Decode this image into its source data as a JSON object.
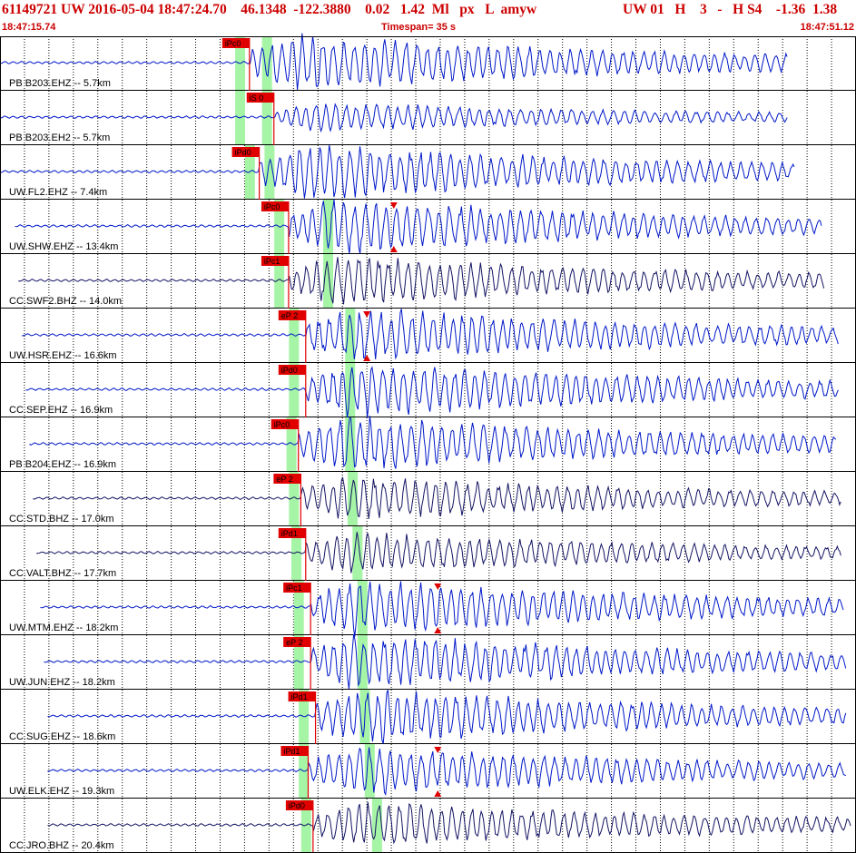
{
  "header": {
    "event_line": "61149721 UW 2016-05-04 18:47:24.70    46.1348  -122.3880    0.02   1.42  Ml   px   L  amyw",
    "quality": "UW 01   H    3   -   H S4    -1.36  1.38",
    "start_time": "18:47:15.74",
    "timespan": "Timespan=  35 s",
    "end_time": "18:47:51.12"
  },
  "colors": {
    "header_text": "#cc0000",
    "trace_blue": "#0018c8",
    "trace_navy": "#141464",
    "pick_flag": "#e00000",
    "window_band": "#a6f5a6",
    "grid": "#000000"
  },
  "chart_data": {
    "type": "line",
    "title": "61149721 UW 2016-05-04 18:47:24.70  46.1348 -122.3880  0.02  1.42 Ml",
    "x_units": "s",
    "x_range": [
      0,
      35
    ],
    "traces": [
      {
        "label": "PB B203.EHZ -- 5.7km",
        "pick": "iPc0",
        "pick_t": 10.2,
        "end_t": 32.2,
        "color": "#0018c8",
        "amp": 1.0,
        "p_window": 9.8,
        "s_window": 10.9,
        "s_marker": false
      },
      {
        "label": "PB B203.EH2 -- 5.7km",
        "pick": "iS 0",
        "pick_t": 11.2,
        "end_t": 32.2,
        "color": "#0018c8",
        "amp": 0.55,
        "p_window": 9.8,
        "s_window": 10.9,
        "s_marker": false
      },
      {
        "label": "UW.FL2.EHZ -- 7.4km",
        "pick": "iPd0",
        "pick_t": 10.6,
        "end_t": 32.5,
        "color": "#0018c8",
        "amp": 1.0,
        "p_window": 10.2,
        "s_window": 11.0,
        "s_marker": false
      },
      {
        "label": "UW.SHW.EHZ -- 13.4km",
        "pick": "iPc0",
        "pick_t": 11.8,
        "end_t": 33.6,
        "color": "#0018c8",
        "amp": 1.0,
        "p_window": 11.4,
        "s_window": 13.4,
        "s_marker": true,
        "s_t": 16.1
      },
      {
        "label": "CC.SWF2.BHZ -- 14.0km",
        "pick": "iPc1",
        "pick_t": 11.8,
        "end_t": 33.7,
        "color": "#141464",
        "amp": 0.9,
        "p_window": 11.4,
        "s_window": 13.4,
        "s_marker": false
      },
      {
        "label": "UW.HSR.EHZ -- 16.6km",
        "pick": "eP 2",
        "pick_t": 12.5,
        "end_t": 34.3,
        "color": "#0018c8",
        "amp": 1.0,
        "p_window": 12.0,
        "s_window": 14.3,
        "s_marker": true,
        "s_t": 15.0
      },
      {
        "label": "CC.SEP.EHZ -- 16.9km",
        "pick": "iPd0",
        "pick_t": 12.5,
        "end_t": 34.3,
        "color": "#0018c8",
        "amp": 1.0,
        "p_window": 12.0,
        "s_window": 14.3,
        "s_marker": false
      },
      {
        "label": "PB B204.EHZ -- 16.9km",
        "pick": "iPc0",
        "pick_t": 12.2,
        "end_t": 34.2,
        "color": "#0018c8",
        "amp": 1.0,
        "p_window": 11.9,
        "s_window": 14.3,
        "s_marker": false
      },
      {
        "label": "CC.STD.BHZ -- 17.0km",
        "pick": "eP 2",
        "pick_t": 12.3,
        "end_t": 34.4,
        "color": "#141464",
        "amp": 0.8,
        "p_window": 12.0,
        "s_window": 14.4,
        "s_marker": false
      },
      {
        "label": "CC.VALT.BHZ -- 17.7km",
        "pick": "iPd1",
        "pick_t": 12.5,
        "end_t": 34.4,
        "color": "#141464",
        "amp": 0.75,
        "p_window": 12.1,
        "s_window": 14.6,
        "s_marker": false
      },
      {
        "label": "UW.MTM.EHZ -- 18.2km",
        "pick": "iPc1",
        "pick_t": 12.7,
        "end_t": 34.5,
        "color": "#0018c8",
        "amp": 1.0,
        "p_window": 12.2,
        "s_window": 14.8,
        "s_marker": true,
        "s_t": 17.9
      },
      {
        "label": "UW.JUN.EHZ -- 18.2km",
        "pick": "eP 2",
        "pick_t": 12.7,
        "end_t": 34.6,
        "color": "#0018c8",
        "amp": 1.0,
        "p_window": 12.2,
        "s_window": 14.8,
        "s_marker": false
      },
      {
        "label": "CC.SUG.EHZ -- 18.6km",
        "pick": "iPd1",
        "pick_t": 12.9,
        "end_t": 34.6,
        "color": "#0018c8",
        "amp": 1.0,
        "p_window": 12.4,
        "s_window": 14.9,
        "s_marker": false
      },
      {
        "label": "UW.ELK.EHZ -- 19.3km",
        "pick": "iPd1",
        "pick_t": 12.6,
        "end_t": 34.6,
        "color": "#0018c8",
        "amp": 0.9,
        "p_window": 12.4,
        "s_window": 15.1,
        "s_marker": true,
        "s_t": 17.9
      },
      {
        "label": "CC.JRO.BHZ -- 20.4km",
        "pick": "iPd0",
        "pick_t": 12.8,
        "end_t": 34.8,
        "color": "#141464",
        "amp": 0.85,
        "p_window": 12.5,
        "s_window": 15.4,
        "s_marker": false
      }
    ]
  }
}
